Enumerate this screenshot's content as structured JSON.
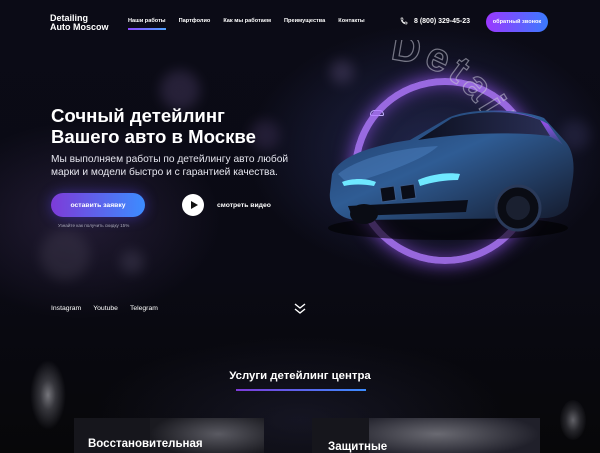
{
  "header": {
    "logo_line1": "Detailing",
    "logo_line2": "Auto Moscow",
    "nav": [
      {
        "label": "Наши работы",
        "active": true
      },
      {
        "label": "Партфолио",
        "active": false
      },
      {
        "label": "Как мы работаем",
        "active": false
      },
      {
        "label": "Преимущества",
        "active": false
      },
      {
        "label": "Контакты",
        "active": false
      }
    ],
    "phone": "8 (800) 329-45-23",
    "callback_label": "обратный звонок"
  },
  "hero": {
    "title_line1": "Сочный детейлинг",
    "title_line2": "Вашего авто в Москве",
    "subtitle": "Мы выполняем работы по детейлингу авто любой марки и модели быстро и с гарантией качества.",
    "cta_label": "оставить заявку",
    "cta_hint": "Узнайте как получить скидку  15%",
    "video_label": "смотреть видео",
    "ring_text": "Detailing"
  },
  "socials": [
    "Instagram",
    "Youtube",
    "Telegram"
  ],
  "services": {
    "title": "Услуги детейлинг центра",
    "cards": [
      {
        "label": "Восстановительная"
      },
      {
        "label": "Защитные"
      }
    ]
  },
  "colors": {
    "accent_start": "#7d3bd8",
    "accent_end": "#3c8cff",
    "ring": "#b078ff",
    "background": "#07070d"
  },
  "icons": {
    "phone": "phone-icon",
    "play": "play-icon",
    "scroll": "double-chevron-down-icon",
    "logo_car": "car-outline-icon"
  }
}
